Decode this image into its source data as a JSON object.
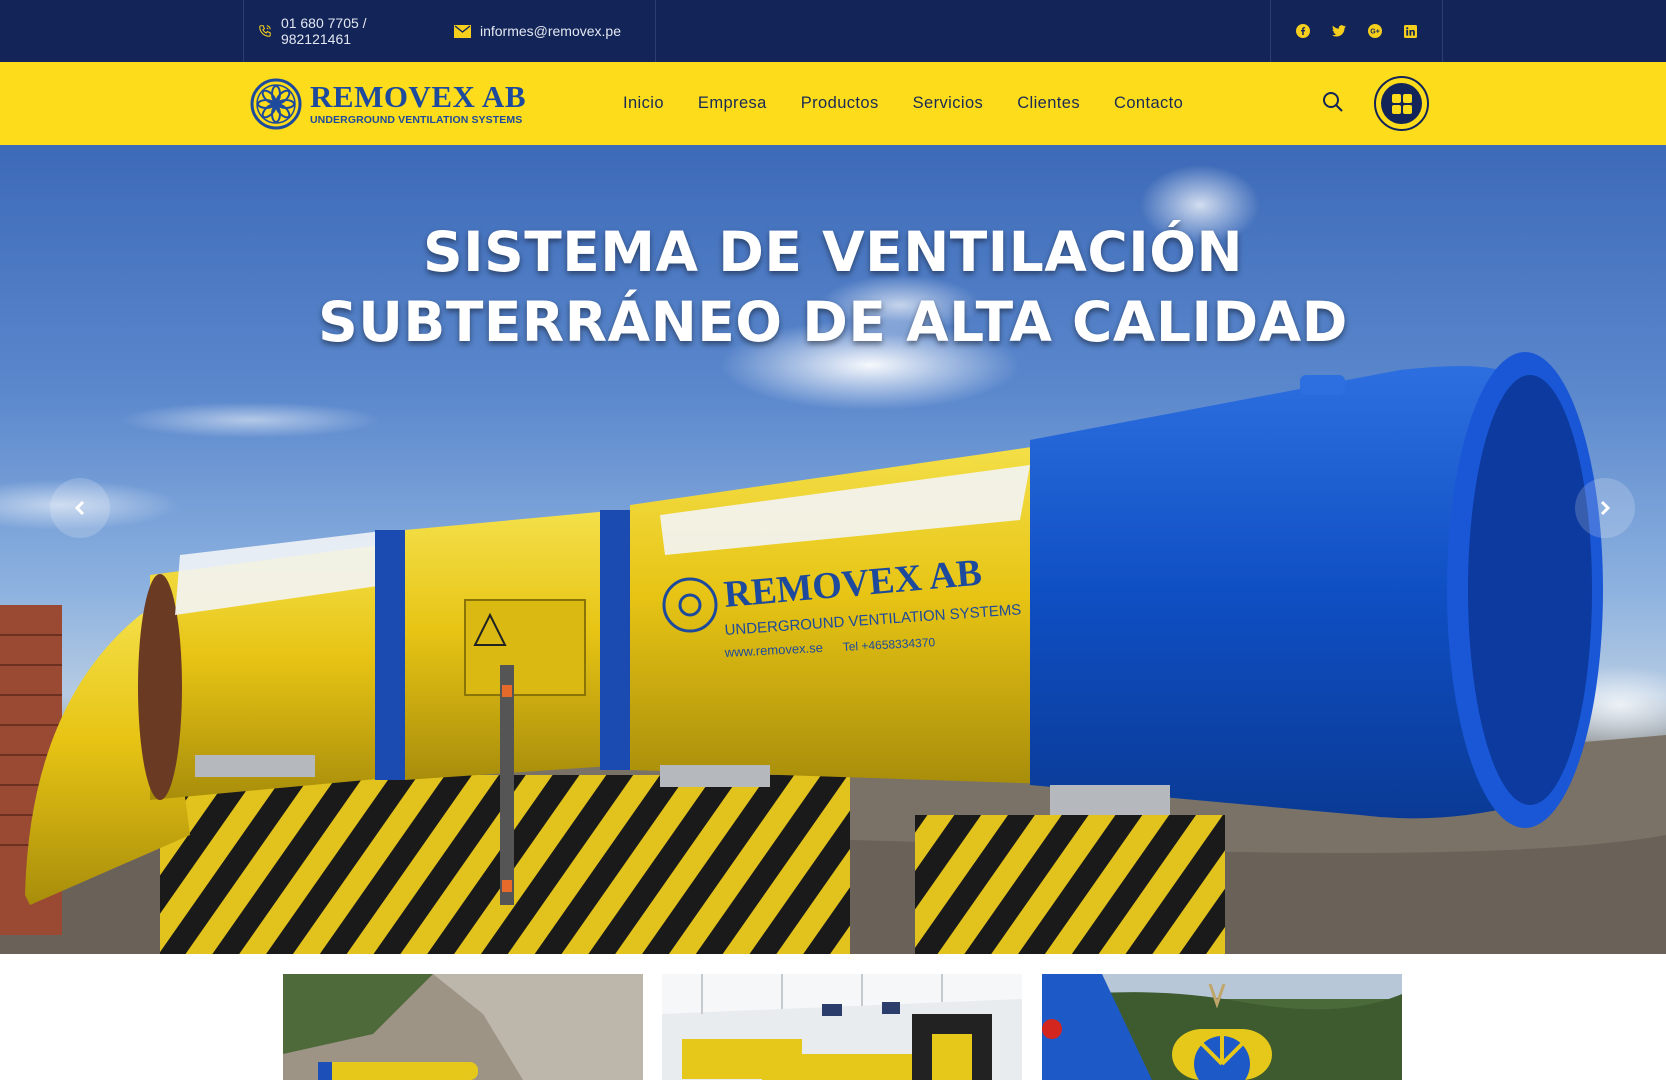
{
  "topbar": {
    "phone": "01 680 7705 / 982121461",
    "email": "informes@removex.pe",
    "social": [
      {
        "icon": "facebook-icon"
      },
      {
        "icon": "twitter-icon"
      },
      {
        "icon": "google-plus-icon"
      },
      {
        "icon": "linkedin-icon"
      }
    ]
  },
  "brand": {
    "name": "REMOVEX AB",
    "tagline": "UNDERGROUND VENTILATION SYSTEMS"
  },
  "nav": {
    "items": [
      "Inicio",
      "Empresa",
      "Productos",
      "Servicios",
      "Clientes",
      "Contacto"
    ]
  },
  "hero": {
    "line1": "SISTEMA DE VENTILACIÓN",
    "line2": "SUBTERRÁNEO DE ALTA CALIDAD",
    "machine_brand": "REMOVEX AB",
    "machine_tagline": "UNDERGROUND VENTILATION SYSTEMS",
    "machine_web": "www.removex.se",
    "machine_tel": "Tel +4658334370"
  },
  "colors": {
    "navy": "#132558",
    "yellow": "#fcdc1b",
    "brand_blue": "#1d4a9c",
    "icon_yellow": "#f5cf1c"
  }
}
